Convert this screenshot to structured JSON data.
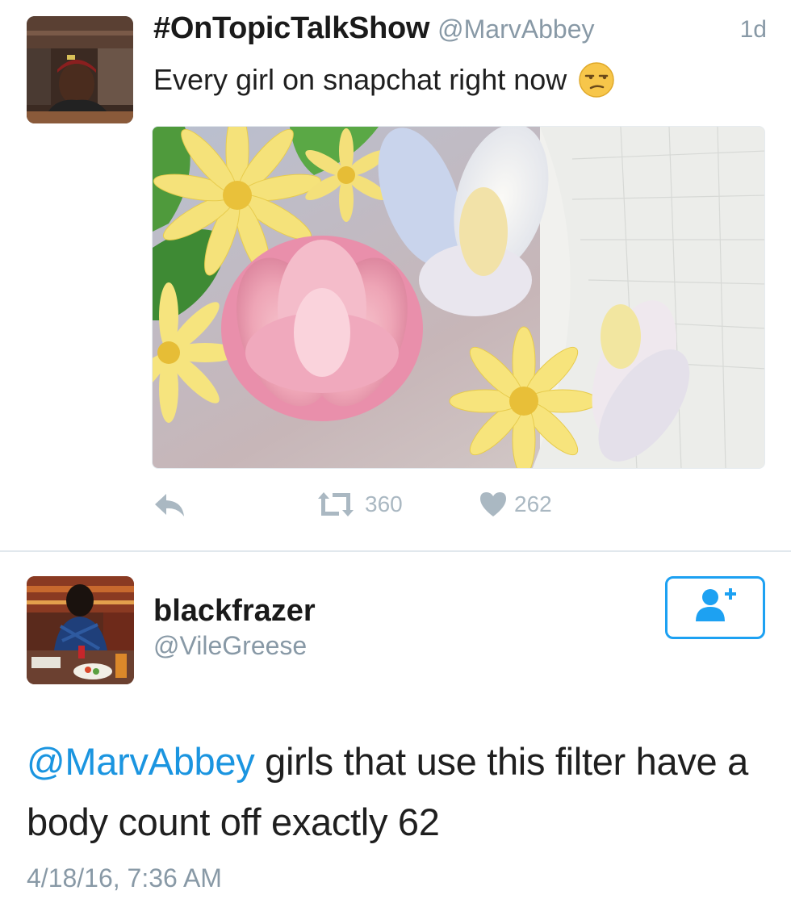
{
  "tweet": {
    "author_name": "#OnTopicTalkShow",
    "author_handle": "@MarvAbbey",
    "timestamp": "1d",
    "text": "Every girl on snapchat right now",
    "emoji_icon": "unamused-face-icon",
    "media_icon": "flower-crown-filter-photo",
    "actions": {
      "reply_icon": "reply-icon",
      "retweet_icon": "retweet-icon",
      "retweet_count": "360",
      "like_icon": "heart-icon",
      "like_count": "262"
    }
  },
  "reply": {
    "author_name": "blackfrazer",
    "author_handle": "@VileGreese",
    "follow_icon": "add-user-icon",
    "mention": "@MarvAbbey",
    "text": " girls that use this filter have a body count off exactly 62",
    "timestamp": "4/18/16, 7:36 AM"
  },
  "colors": {
    "accent": "#1da1f2",
    "mention": "#1b95e0",
    "muted": "#8899a6",
    "action_gray": "#aab8c2",
    "divider": "#e1e8ed"
  }
}
